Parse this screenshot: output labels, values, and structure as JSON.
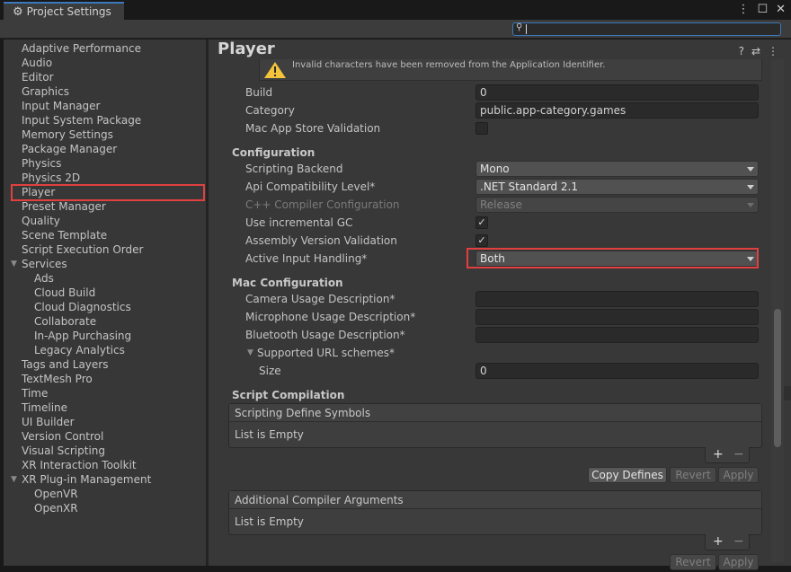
{
  "window": {
    "tab_title": "Project Settings",
    "tab_icon": "gear-icon",
    "buttons": [
      "kebab-menu-icon",
      "maximize-icon",
      "close-icon"
    ]
  },
  "search": {
    "value": "",
    "icon": "search-icon"
  },
  "sidebar": {
    "items": [
      "Adaptive Performance",
      "Audio",
      "Editor",
      "Graphics",
      "Input Manager",
      "Input System Package",
      "Memory Settings",
      "Package Manager",
      "Physics",
      "Physics 2D",
      "Player",
      "Preset Manager",
      "Quality",
      "Scene Template",
      "Script Execution Order",
      "Services",
      "Ads",
      "Cloud Build",
      "Cloud Diagnostics",
      "Collaborate",
      "In-App Purchasing",
      "Legacy Analytics",
      "Tags and Layers",
      "TextMesh Pro",
      "Time",
      "Timeline",
      "UI Builder",
      "Version Control",
      "Visual Scripting",
      "XR Interaction Toolkit",
      "XR Plug-in Management",
      "OpenVR",
      "OpenXR"
    ],
    "selected": "Player"
  },
  "main": {
    "title": "Player",
    "warning": "Invalid characters have been removed from the Application Identifier.",
    "build_label": "Build",
    "build_value": "0",
    "category_label": "Category",
    "category_value": "public.app-category.games",
    "mac_validation_label": "Mac App Store Validation",
    "configuration": {
      "title": "Configuration",
      "scripting_backend_label": "Scripting Backend",
      "scripting_backend_value": "Mono",
      "api_label": "Api Compatibility Level*",
      "api_value": ".NET Standard 2.1",
      "cpp_label": "C++ Compiler Configuration",
      "cpp_value": "Release",
      "incremental_gc_label": "Use incremental GC",
      "assembly_validation_label": "Assembly Version Validation",
      "input_handling_label": "Active Input Handling*",
      "input_handling_value": "Both"
    },
    "mac_configuration": {
      "title": "Mac Configuration",
      "camera_label": "Camera Usage Description*",
      "microphone_label": "Microphone Usage Description*",
      "bluetooth_label": "Bluetooth Usage Description*",
      "url_schemes_label": "Supported URL schemes*",
      "size_label": "Size",
      "size_value": "0"
    },
    "script_compilation": {
      "title": "Script Compilation",
      "define_symbols_header": "Scripting Define Symbols",
      "define_symbols_empty": "List is Empty",
      "copy_defines": "Copy Defines",
      "revert": "Revert",
      "apply": "Apply",
      "compiler_args_header": "Additional Compiler Arguments",
      "compiler_args_empty": "List is Empty",
      "plus": "+",
      "minus": "−"
    }
  }
}
